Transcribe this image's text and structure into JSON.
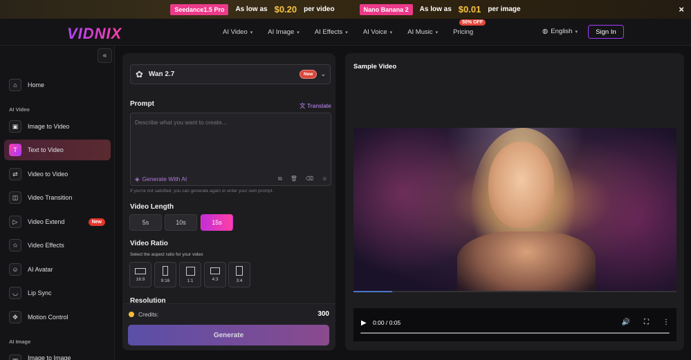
{
  "promo": {
    "items": [
      {
        "tag": "Seedance1.5 Pro",
        "prefix": "As low as",
        "price": "$0.20",
        "suffix": "per video"
      },
      {
        "tag": "Nano Banana 2",
        "prefix": "As low as",
        "price": "$0.01",
        "suffix": "per image"
      }
    ],
    "close": "×"
  },
  "nav": {
    "logo": "VIDNIX",
    "menu": [
      "AI Video",
      "AI Image",
      "AI Effects",
      "AI Voice",
      "AI Music"
    ],
    "pricing": "Pricing",
    "pricing_badge": "50% OFF",
    "language": "English",
    "signin": "Sign In"
  },
  "sidebar": {
    "collapse": "«",
    "items": [
      {
        "label": "Home",
        "icon": "home-icon",
        "glyph": "⌂"
      },
      {
        "label": "Image to Video",
        "icon": "image-to-video-icon",
        "glyph": "▣"
      },
      {
        "label": "Text to Video",
        "icon": "text-to-video-icon",
        "glyph": "T"
      },
      {
        "label": "Video to Video",
        "icon": "video-to-video-icon",
        "glyph": "⇄"
      },
      {
        "label": "Video Transition",
        "icon": "video-transition-icon",
        "glyph": "◫"
      },
      {
        "label": "Video Extend",
        "icon": "video-extend-icon",
        "glyph": "▷",
        "badge": "New"
      },
      {
        "label": "Video Effects",
        "icon": "star-icon",
        "glyph": "☆"
      },
      {
        "label": "AI Avatar",
        "icon": "avatar-icon",
        "glyph": "☺"
      },
      {
        "label": "Lip Sync",
        "icon": "lip-sync-icon",
        "glyph": "◡"
      },
      {
        "label": "Motion Control",
        "icon": "motion-control-icon",
        "glyph": "✥"
      },
      {
        "label": "Image to Image",
        "icon": "image-to-image-icon",
        "glyph": "▣"
      }
    ],
    "sections": [
      "AI Video",
      "AI Image"
    ]
  },
  "form": {
    "model": "Wan 2.7",
    "model_badge": "New",
    "prompt_label": "Prompt",
    "translate": "Translate",
    "prompt_placeholder": "Describe what you want to create...",
    "generate_ai": "Generate With AI",
    "hint": "If you're not satisfied, you can generate again or enter your own prompt.",
    "length_label": "Video Length",
    "lengths": [
      "5s",
      "10s",
      "15s"
    ],
    "selected_length": "15s",
    "ratio_label": "Video Ratio",
    "ratio_sub": "Select the aspect ratio for your video",
    "ratios": [
      "16:9",
      "9:16",
      "1:1",
      "4:3",
      "3:4"
    ],
    "resolution_label": "Resolution",
    "credits_label": "Credits:",
    "credits_value": "300",
    "generate": "Generate"
  },
  "sample": {
    "title": "Sample Video",
    "time": "0:00 / 0:05",
    "progress": 0.12
  },
  "colors": {
    "accent": "#a13bff",
    "brand_pink": "#ff3fa4",
    "badge_red": "#e5372c"
  }
}
